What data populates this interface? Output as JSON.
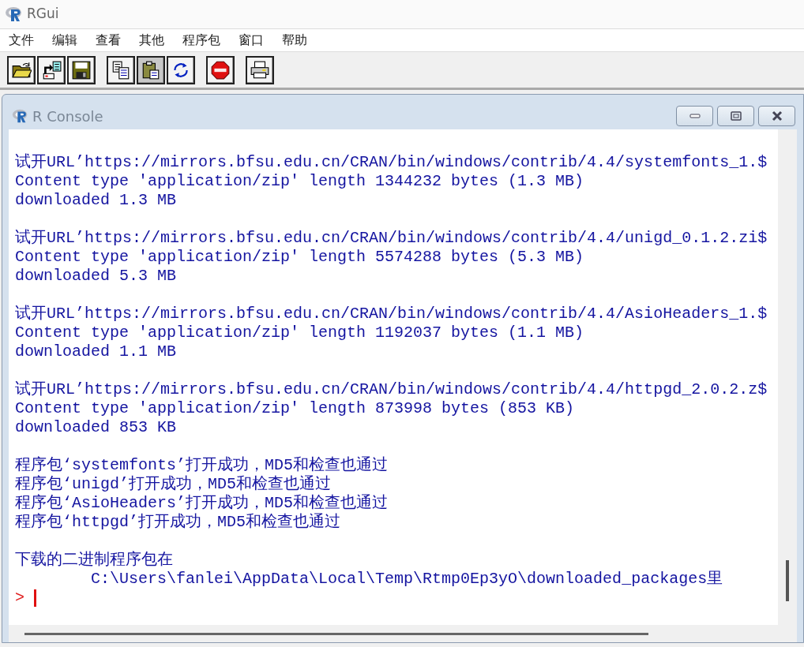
{
  "window": {
    "title": "RGui"
  },
  "menu": [
    "文件",
    "编辑",
    "查看",
    "其他",
    "程序包",
    "窗口",
    "帮助"
  ],
  "toolbar": [
    {
      "kind": "open",
      "disabled": false
    },
    {
      "kind": "load",
      "disabled": false
    },
    {
      "kind": "save",
      "disabled": false
    },
    {
      "kind": "separator"
    },
    {
      "kind": "copy",
      "disabled": false
    },
    {
      "kind": "paste",
      "disabled": true
    },
    {
      "kind": "copy-paste",
      "disabled": false
    },
    {
      "kind": "separator"
    },
    {
      "kind": "stop",
      "disabled": false
    },
    {
      "kind": "separator"
    },
    {
      "kind": "print",
      "disabled": false
    }
  ],
  "console": {
    "title": "R Console",
    "lines": [
      {
        "kind": "output",
        "text": "试开URL’https://mirrors.bfsu.edu.cn/CRAN/bin/windows/contrib/4.4/systemfonts_1.$"
      },
      {
        "kind": "output",
        "text": "Content type 'application/zip' length 1344232 bytes (1.3 MB)"
      },
      {
        "kind": "output",
        "text": "downloaded 1.3 MB"
      },
      {
        "kind": "blank"
      },
      {
        "kind": "output",
        "text": "试开URL’https://mirrors.bfsu.edu.cn/CRAN/bin/windows/contrib/4.4/unigd_0.1.2.zi$"
      },
      {
        "kind": "output",
        "text": "Content type 'application/zip' length 5574288 bytes (5.3 MB)"
      },
      {
        "kind": "output",
        "text": "downloaded 5.3 MB"
      },
      {
        "kind": "blank"
      },
      {
        "kind": "output",
        "text": "试开URL’https://mirrors.bfsu.edu.cn/CRAN/bin/windows/contrib/4.4/AsioHeaders_1.$"
      },
      {
        "kind": "output",
        "text": "Content type 'application/zip' length 1192037 bytes (1.1 MB)"
      },
      {
        "kind": "output",
        "text": "downloaded 1.1 MB"
      },
      {
        "kind": "blank"
      },
      {
        "kind": "output",
        "text": "试开URL’https://mirrors.bfsu.edu.cn/CRAN/bin/windows/contrib/4.4/httpgd_2.0.2.z$"
      },
      {
        "kind": "output",
        "text": "Content type 'application/zip' length 873998 bytes (853 KB)"
      },
      {
        "kind": "output",
        "text": "downloaded 853 KB"
      },
      {
        "kind": "blank"
      },
      {
        "kind": "output",
        "text": "程序包‘systemfonts’打开成功，MD5和检查也通过"
      },
      {
        "kind": "output",
        "text": "程序包‘unigd’打开成功，MD5和检查也通过"
      },
      {
        "kind": "output",
        "text": "程序包‘AsioHeaders’打开成功，MD5和检查也通过"
      },
      {
        "kind": "output",
        "text": "程序包‘httpgd’打开成功，MD5和检查也通过"
      },
      {
        "kind": "blank"
      },
      {
        "kind": "output",
        "text": "下载的二进制程序包在"
      },
      {
        "kind": "output",
        "text": "        C:\\Users\\fanlei\\AppData\\Local\\Temp\\Rtmp0Ep3yO\\downloaded_packages里"
      },
      {
        "kind": "prompt",
        "text": ">"
      }
    ]
  }
}
